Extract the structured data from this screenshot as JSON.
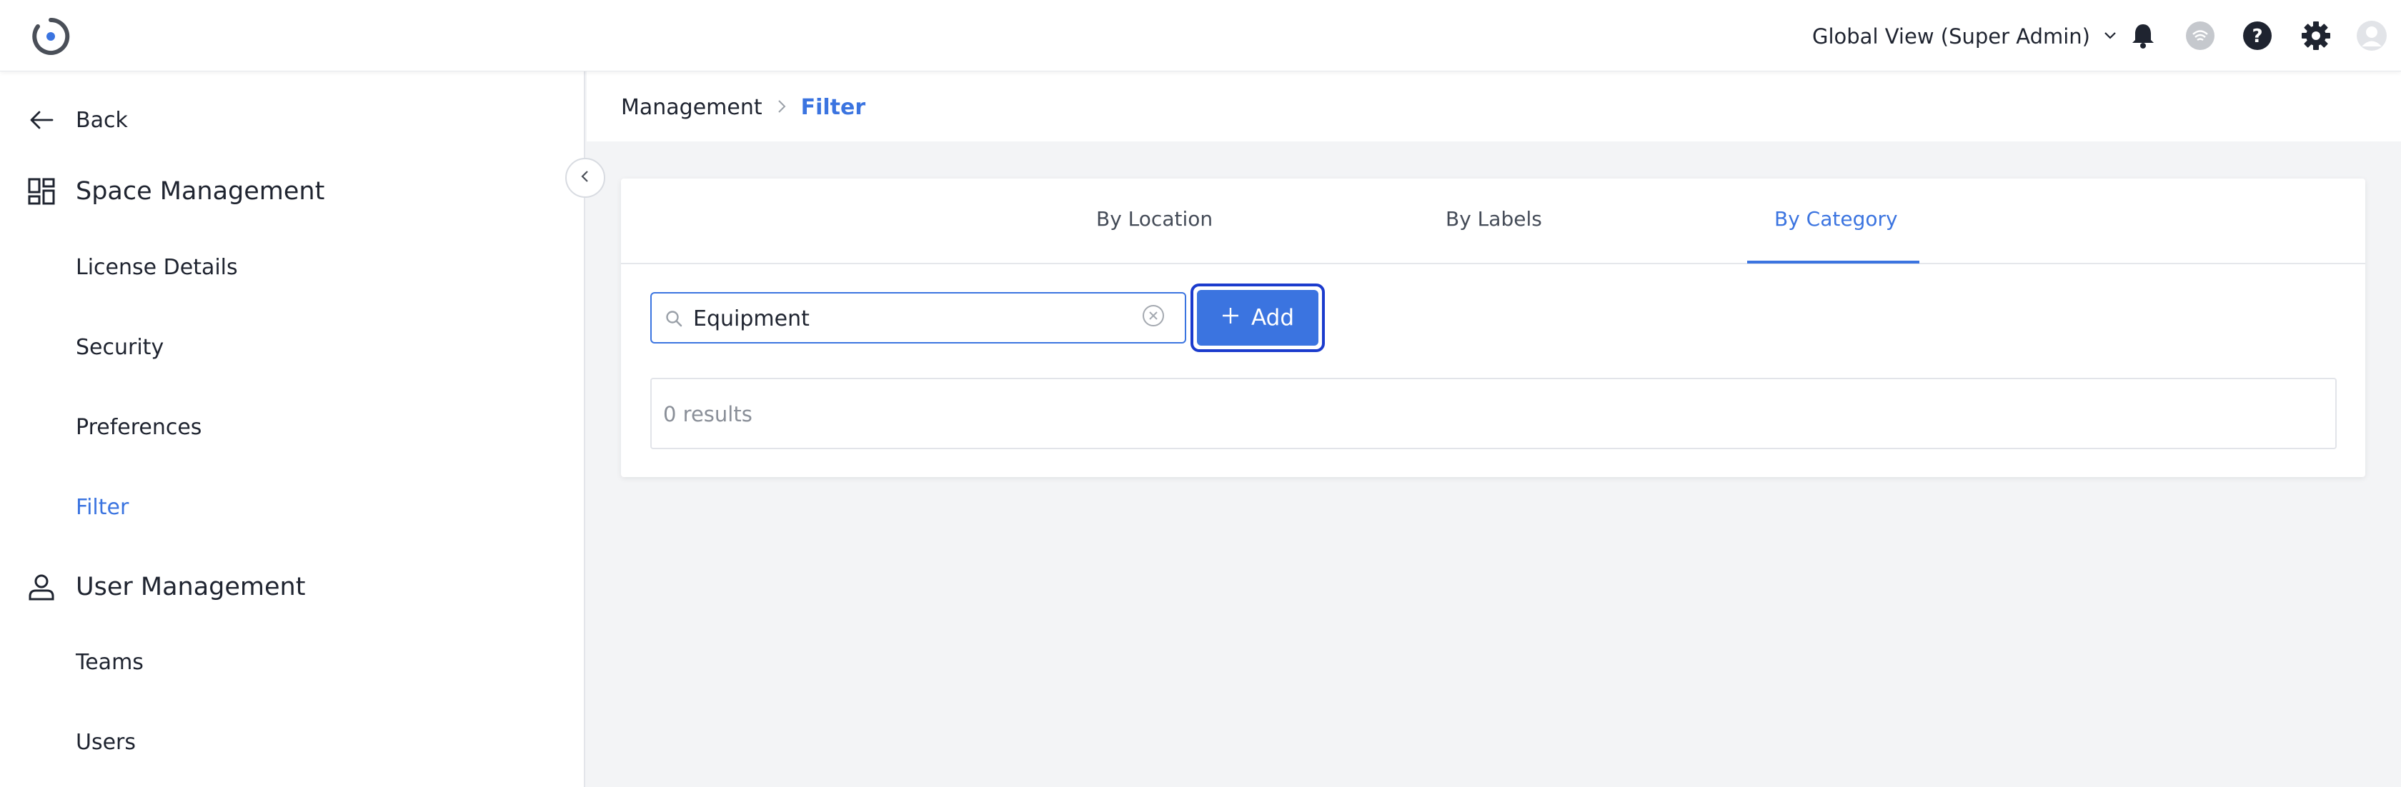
{
  "header": {
    "global_view_label": "Global View (Super Admin)",
    "icons": [
      "bell-icon",
      "signal-icon",
      "help-icon",
      "settings-icon",
      "avatar-icon"
    ]
  },
  "sidebar": {
    "back_label": "Back",
    "space_management_label": "Space Management",
    "space_items": [
      {
        "label": "License Details"
      },
      {
        "label": "Security"
      },
      {
        "label": "Preferences"
      },
      {
        "label": "Filter",
        "active": true
      }
    ],
    "user_management_label": "User Management",
    "user_items": [
      {
        "label": "Teams"
      },
      {
        "label": "Users"
      }
    ]
  },
  "breadcrumb": {
    "parent": "Management",
    "current": "Filter"
  },
  "tabs": [
    {
      "label": "By Location"
    },
    {
      "label": "By Labels"
    },
    {
      "label": "By Category",
      "active": true
    }
  ],
  "search": {
    "value": "Equipment",
    "placeholder": ""
  },
  "add_button_label": "Add",
  "results_text": "0 results",
  "colors": {
    "accent": "#3b74e0",
    "focus_ring": "#1b3bcd",
    "background": "#f3f4f6"
  }
}
